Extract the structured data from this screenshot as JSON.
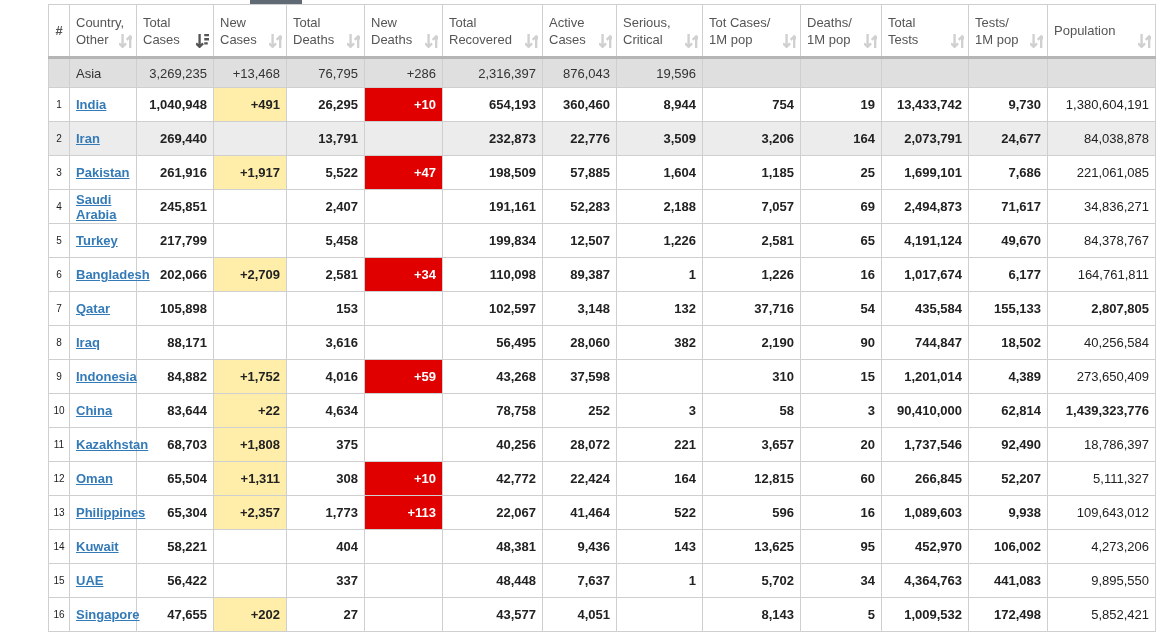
{
  "columns": [
    {
      "label": "#",
      "sortable": false
    },
    {
      "label": "Country,\nOther",
      "sortable": true,
      "sorted": false
    },
    {
      "label": "Total\nCases",
      "sortable": true,
      "sorted": true
    },
    {
      "label": "New\nCases",
      "sortable": true,
      "sorted": false
    },
    {
      "label": "Total\nDeaths",
      "sortable": true,
      "sorted": false
    },
    {
      "label": "New\nDeaths",
      "sortable": true,
      "sorted": false
    },
    {
      "label": "Total\nRecovered",
      "sortable": true,
      "sorted": false
    },
    {
      "label": "Active\nCases",
      "sortable": true,
      "sorted": false
    },
    {
      "label": "Serious,\nCritical",
      "sortable": true,
      "sorted": false
    },
    {
      "label": "Tot Cases/\n1M pop",
      "sortable": true,
      "sorted": false
    },
    {
      "label": "Deaths/\n1M pop",
      "sortable": true,
      "sorted": false
    },
    {
      "label": "Total\nTests",
      "sortable": true,
      "sorted": false
    },
    {
      "label": "Tests/\n1M pop",
      "sortable": true,
      "sorted": false
    },
    {
      "label": "Population",
      "sortable": true,
      "sorted": false
    }
  ],
  "summary": {
    "country": "Asia",
    "total_cases": "3,269,235",
    "new_cases": "+13,468",
    "total_deaths": "76,795",
    "new_deaths": "+286",
    "total_recovered": "2,316,397",
    "active_cases": "876,043",
    "serious_critical": "19,596"
  },
  "rows": [
    {
      "rank": "1",
      "country": "India",
      "total_cases": "1,040,948",
      "new_cases": "+491",
      "total_deaths": "26,295",
      "new_deaths": "+10",
      "total_recovered": "654,193",
      "active_cases": "360,460",
      "serious_critical": "8,944",
      "tot_cases_1m": "754",
      "deaths_1m": "19",
      "total_tests": "13,433,742",
      "tests_1m": "9,730",
      "population": "1,380,604,191",
      "population_link": true,
      "hovered": false
    },
    {
      "rank": "2",
      "country": "Iran",
      "total_cases": "269,440",
      "total_deaths": "13,791",
      "total_recovered": "232,873",
      "active_cases": "22,776",
      "serious_critical": "3,509",
      "tot_cases_1m": "3,206",
      "deaths_1m": "164",
      "total_tests": "2,073,791",
      "tests_1m": "24,677",
      "population": "84,038,878",
      "population_link": true,
      "hovered": true
    },
    {
      "rank": "3",
      "country": "Pakistan",
      "total_cases": "261,916",
      "new_cases": "+1,917",
      "total_deaths": "5,522",
      "new_deaths": "+47",
      "total_recovered": "198,509",
      "active_cases": "57,885",
      "serious_critical": "1,604",
      "tot_cases_1m": "1,185",
      "deaths_1m": "25",
      "total_tests": "1,699,101",
      "tests_1m": "7,686",
      "population": "221,061,085",
      "population_link": true,
      "hovered": false
    },
    {
      "rank": "4",
      "country": "Saudi Arabia",
      "total_cases": "245,851",
      "total_deaths": "2,407",
      "total_recovered": "191,161",
      "active_cases": "52,283",
      "serious_critical": "2,188",
      "tot_cases_1m": "7,057",
      "deaths_1m": "69",
      "total_tests": "2,494,873",
      "tests_1m": "71,617",
      "population": "34,836,271",
      "population_link": true,
      "hovered": false
    },
    {
      "rank": "5",
      "country": "Turkey",
      "total_cases": "217,799",
      "total_deaths": "5,458",
      "total_recovered": "199,834",
      "active_cases": "12,507",
      "serious_critical": "1,226",
      "tot_cases_1m": "2,581",
      "deaths_1m": "65",
      "total_tests": "4,191,124",
      "tests_1m": "49,670",
      "population": "84,378,767",
      "population_link": true,
      "hovered": false
    },
    {
      "rank": "6",
      "country": "Bangladesh",
      "total_cases": "202,066",
      "new_cases": "+2,709",
      "total_deaths": "2,581",
      "new_deaths": "+34",
      "total_recovered": "110,098",
      "active_cases": "89,387",
      "serious_critical": "1",
      "tot_cases_1m": "1,226",
      "deaths_1m": "16",
      "total_tests": "1,017,674",
      "tests_1m": "6,177",
      "population": "164,761,811",
      "population_link": true,
      "hovered": false
    },
    {
      "rank": "7",
      "country": "Qatar",
      "total_cases": "105,898",
      "total_deaths": "153",
      "total_recovered": "102,597",
      "active_cases": "3,148",
      "serious_critical": "132",
      "tot_cases_1m": "37,716",
      "deaths_1m": "54",
      "total_tests": "435,584",
      "tests_1m": "155,133",
      "population": "2,807,805",
      "population_link": false,
      "hovered": false
    },
    {
      "rank": "8",
      "country": "Iraq",
      "total_cases": "88,171",
      "total_deaths": "3,616",
      "total_recovered": "56,495",
      "active_cases": "28,060",
      "serious_critical": "382",
      "tot_cases_1m": "2,190",
      "deaths_1m": "90",
      "total_tests": "744,847",
      "tests_1m": "18,502",
      "population": "40,256,584",
      "population_link": true,
      "hovered": false
    },
    {
      "rank": "9",
      "country": "Indonesia",
      "total_cases": "84,882",
      "new_cases": "+1,752",
      "total_deaths": "4,016",
      "new_deaths": "+59",
      "total_recovered": "43,268",
      "active_cases": "37,598",
      "tot_cases_1m": "310",
      "deaths_1m": "15",
      "total_tests": "1,201,014",
      "tests_1m": "4,389",
      "population": "273,650,409",
      "population_link": true,
      "hovered": false
    },
    {
      "rank": "10",
      "country": "China",
      "total_cases": "83,644",
      "new_cases": "+22",
      "total_deaths": "4,634",
      "total_recovered": "78,758",
      "active_cases": "252",
      "serious_critical": "3",
      "tot_cases_1m": "58",
      "deaths_1m": "3",
      "total_tests": "90,410,000",
      "tests_1m": "62,814",
      "population": "1,439,323,776",
      "population_link": false,
      "hovered": false
    },
    {
      "rank": "11",
      "country": "Kazakhstan",
      "total_cases": "68,703",
      "new_cases": "+1,808",
      "total_deaths": "375",
      "total_recovered": "40,256",
      "active_cases": "28,072",
      "serious_critical": "221",
      "tot_cases_1m": "3,657",
      "deaths_1m": "20",
      "total_tests": "1,737,546",
      "tests_1m": "92,490",
      "population": "18,786,397",
      "population_link": true,
      "hovered": false
    },
    {
      "rank": "12",
      "country": "Oman",
      "total_cases": "65,504",
      "new_cases": "+1,311",
      "total_deaths": "308",
      "new_deaths": "+10",
      "total_recovered": "42,772",
      "active_cases": "22,424",
      "serious_critical": "164",
      "tot_cases_1m": "12,815",
      "deaths_1m": "60",
      "total_tests": "266,845",
      "tests_1m": "52,207",
      "population": "5,111,327",
      "population_link": true,
      "hovered": false
    },
    {
      "rank": "13",
      "country": "Philippines",
      "total_cases": "65,304",
      "new_cases": "+2,357",
      "total_deaths": "1,773",
      "new_deaths": "+113",
      "total_recovered": "22,067",
      "active_cases": "41,464",
      "serious_critical": "522",
      "tot_cases_1m": "596",
      "deaths_1m": "16",
      "total_tests": "1,089,603",
      "tests_1m": "9,938",
      "population": "109,643,012",
      "population_link": true,
      "hovered": false
    },
    {
      "rank": "14",
      "country": "Kuwait",
      "total_cases": "58,221",
      "total_deaths": "404",
      "total_recovered": "48,381",
      "active_cases": "9,436",
      "serious_critical": "143",
      "tot_cases_1m": "13,625",
      "deaths_1m": "95",
      "total_tests": "452,970",
      "tests_1m": "106,002",
      "population": "4,273,206",
      "population_link": true,
      "hovered": false
    },
    {
      "rank": "15",
      "country": "UAE",
      "total_cases": "56,422",
      "total_deaths": "337",
      "total_recovered": "48,448",
      "active_cases": "7,637",
      "serious_critical": "1",
      "tot_cases_1m": "5,702",
      "deaths_1m": "34",
      "total_tests": "4,364,763",
      "tests_1m": "441,083",
      "population": "9,895,550",
      "population_link": true,
      "hovered": false
    },
    {
      "rank": "16",
      "country": "Singapore",
      "total_cases": "47,655",
      "new_cases": "+202",
      "total_deaths": "27",
      "total_recovered": "43,577",
      "active_cases": "4,051",
      "tot_cases_1m": "8,143",
      "deaths_1m": "5",
      "total_tests": "1,009,532",
      "tests_1m": "172,498",
      "population": "5,852,421",
      "population_link": true,
      "hovered": false
    }
  ]
}
